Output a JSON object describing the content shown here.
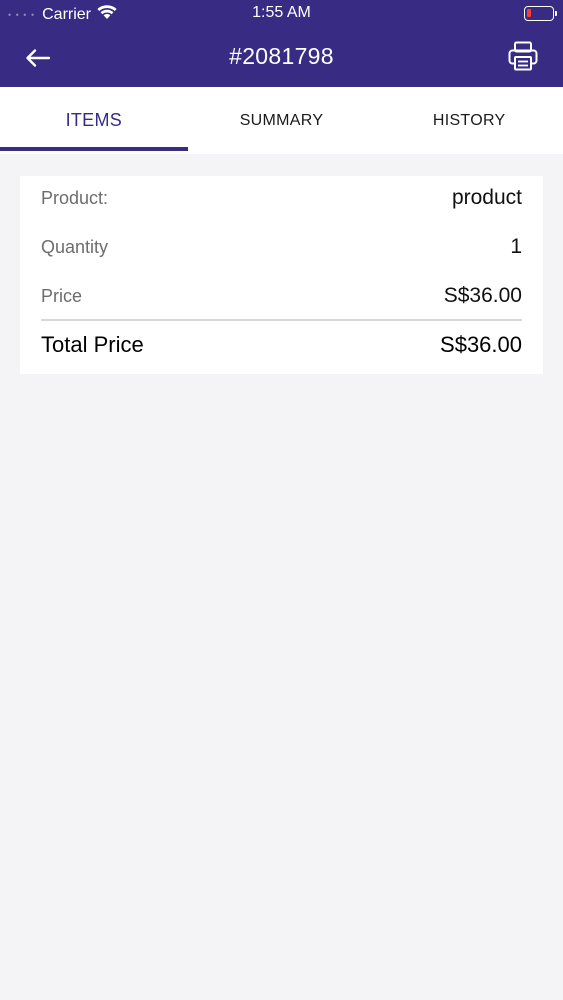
{
  "status_bar": {
    "carrier": "Carrier",
    "time": "1:55 AM",
    "battery_color": "#ff3b30"
  },
  "nav": {
    "title": "#2081798",
    "back_icon": "arrow-left-icon",
    "print_icon": "printer-icon",
    "background": "#372b84"
  },
  "tabs": [
    {
      "label": "ITEMS",
      "active": true
    },
    {
      "label": "SUMMARY",
      "active": false
    },
    {
      "label": "HISTORY",
      "active": false
    }
  ],
  "item": {
    "product_label": "Product:",
    "product_value": "product",
    "quantity_label": "Quantity",
    "quantity_value": "1",
    "price_label": "Price",
    "price_value": "S$36.00",
    "total_label": "Total Price",
    "total_value": "S$36.00"
  }
}
